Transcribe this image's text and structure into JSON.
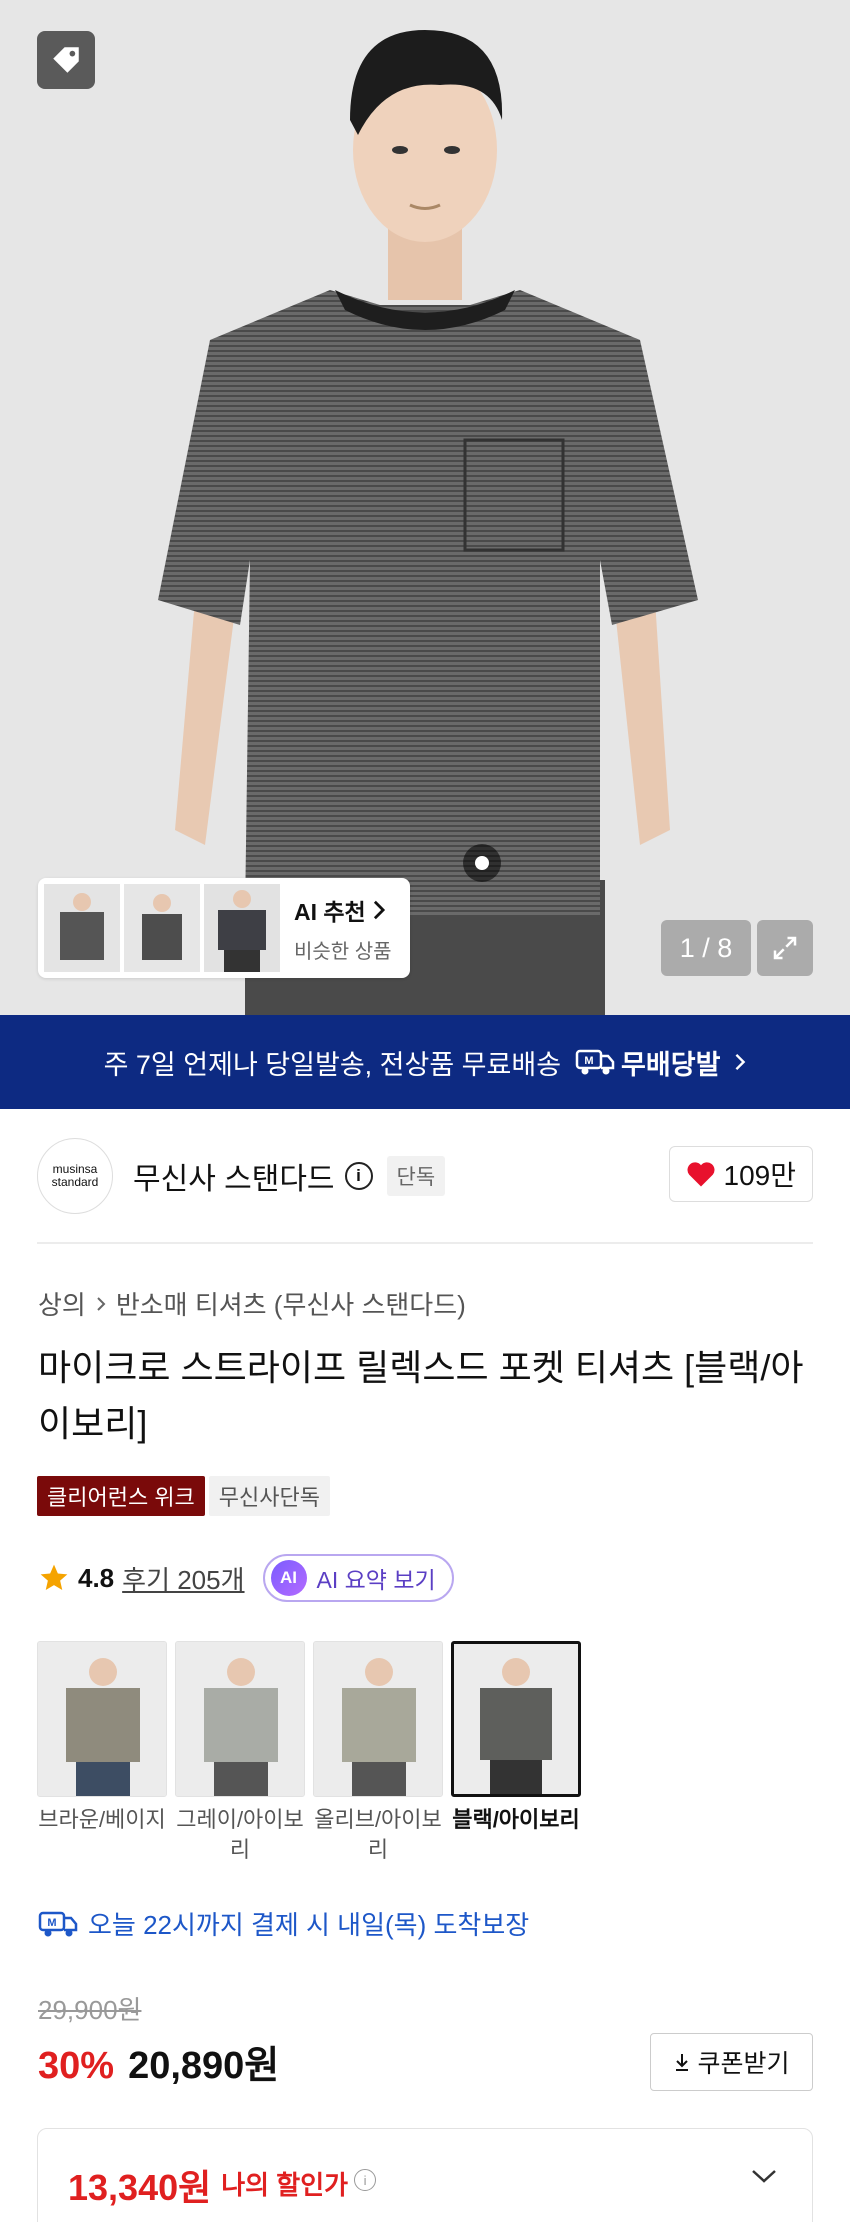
{
  "hero": {
    "counter": "1 / 8",
    "ai_recommend": {
      "title": "AI 추천",
      "subtitle": "비슷한 상품"
    }
  },
  "banner": {
    "text": "주 7일 언제나 당일발송, 전상품 무료배송",
    "badge": "무배당발"
  },
  "brand": {
    "logo_line1": "musinsa",
    "logo_line2": "standard",
    "name": "무신사 스탠다드",
    "exclusive_chip": "단독",
    "likes": "109만"
  },
  "breadcrumb": {
    "level1": "상의",
    "level2": "반소매 티셔츠 (무신사 스탠다드)"
  },
  "product": {
    "title": "마이크로 스트라이프 릴렉스드 포켓 티셔츠 [블랙/아이보리]",
    "chip_clearance": "클리어런스 위크",
    "chip_exclusive": "무신사단독"
  },
  "rating": {
    "score": "4.8",
    "reviews": "후기 205개",
    "ai_circle": "AI",
    "ai_summary": "AI 요약 보기"
  },
  "colors": [
    {
      "label": "브라운/베이지",
      "shirt": "#8f8b7d"
    },
    {
      "label": "그레이/아이보리",
      "shirt": "#a9aca6"
    },
    {
      "label": "올리브/아이보리",
      "shirt": "#a8a89a"
    },
    {
      "label": "블랙/아이보리",
      "shirt": "#5e5f5c"
    }
  ],
  "delivery": {
    "text": "오늘 22시까지 결제 시 내일(목) 도착보장"
  },
  "price": {
    "original": "29,900원",
    "discount": "30%",
    "sale": "20,890원",
    "coupon": "쿠폰받기",
    "my_price": "13,340원",
    "my_price_label": "나의 할인가"
  },
  "theme": {
    "navy": "#0d2a82",
    "red": "#e02020",
    "clearance": "#7a0a0a",
    "ai_purple": "#5b3fc4"
  }
}
